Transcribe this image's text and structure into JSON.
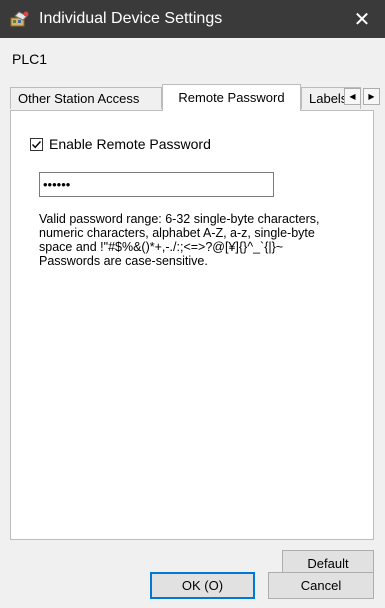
{
  "window": {
    "title": "Individual Device Settings",
    "close_glyph": "✕",
    "icon": "plc-app-icon"
  },
  "device": {
    "name": "PLC1"
  },
  "tabs": [
    {
      "label": "Other Station Access",
      "active": false
    },
    {
      "label": "Remote Password",
      "active": true
    },
    {
      "label": "Labels",
      "active": false
    }
  ],
  "tab_scroll": {
    "left_glyph": "◀",
    "right_glyph": "▶"
  },
  "remote_password": {
    "enable_label": "Enable Remote Password",
    "enabled": true,
    "password_value": "••••••",
    "help_lines": [
      "Valid password range: 6-32 single-byte characters,",
      "numeric characters, alphabet A-Z, a-z, single-byte",
      "space and !\"#$%&()*+,-./:;<=>?@[¥]{}^_`{|}~",
      "Passwords are case-sensitive."
    ]
  },
  "buttons": {
    "default_label": "Default",
    "ok_label": "OK (O)",
    "cancel_label": "Cancel"
  },
  "colors": {
    "titlebar": "#3a3a3a",
    "focus_border": "#0078d7"
  }
}
